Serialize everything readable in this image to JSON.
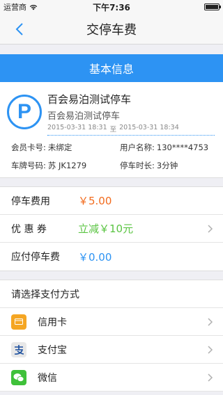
{
  "status_bar": {
    "carrier": "运营商",
    "time": "下午7:36"
  },
  "nav": {
    "title": "交停车费"
  },
  "basic_info": {
    "header": "基本信息",
    "logo_letter": "P",
    "lot_name": "百会易泊测试停车",
    "lot_subname": "百会易泊测试停车",
    "start_time": "2015-03-31 18:31",
    "to_label": "至",
    "end_time": "2015-03-31 18:34",
    "member_card_label": "会员卡号:",
    "member_card_value": "未绑定",
    "username_label": "用户名称:",
    "username_value": "130****4753",
    "plate_label": "车牌号码:",
    "plate_value": "苏  JK1279",
    "duration_label": "停车时长:",
    "duration_value": "3分钟"
  },
  "fees": {
    "parking_fee_label": "停车费用",
    "parking_fee_value": "￥5.00",
    "coupon_label": "优 惠 券",
    "coupon_value": "立减￥10元",
    "payable_label": "应付停车费",
    "payable_value": "￥0.00"
  },
  "payment": {
    "header": "请选择支付方式",
    "methods": [
      {
        "label": "信用卡",
        "icon": "credit-card-icon",
        "color": "#f5a623"
      },
      {
        "label": "支付宝",
        "icon": "alipay-icon",
        "color": "#e0e0e0"
      },
      {
        "label": "微信",
        "icon": "wechat-icon",
        "color": "#3fc13a"
      }
    ]
  },
  "colors": {
    "accent": "#2d93f3",
    "orange": "#f26b1d",
    "green": "#5ac442"
  }
}
